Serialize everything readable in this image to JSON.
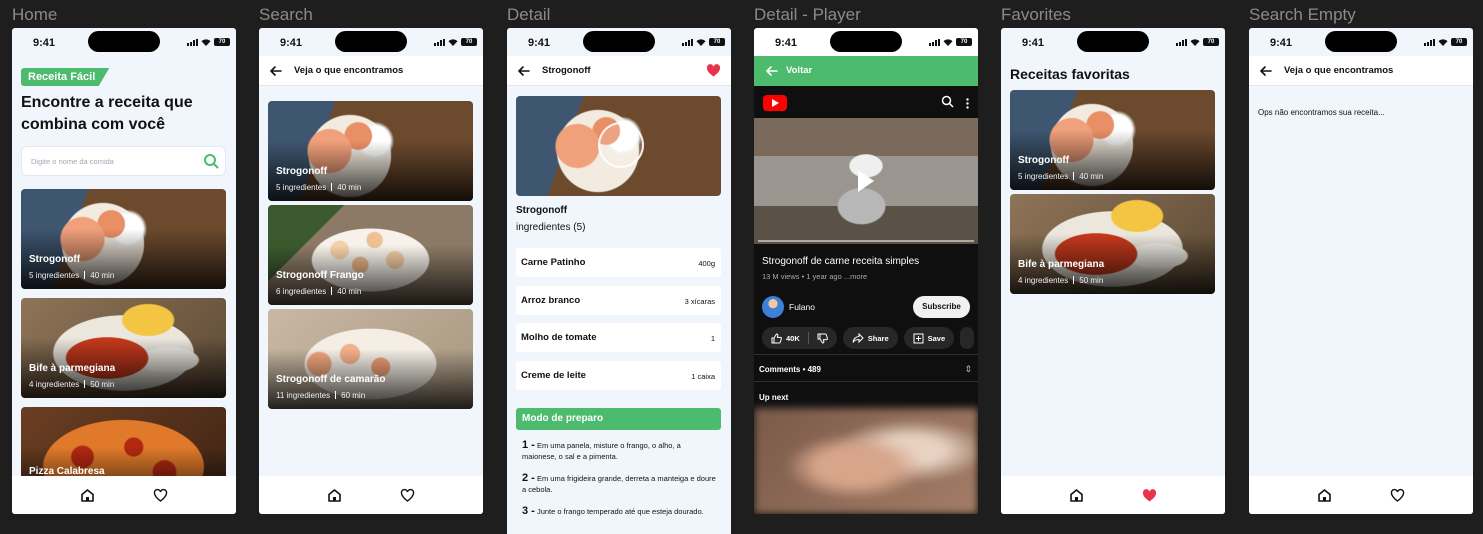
{
  "frames": [
    {
      "label": "Home"
    },
    {
      "label": "Search"
    },
    {
      "label": "Detail"
    },
    {
      "label": "Detail - Player"
    },
    {
      "label": "Favorites"
    },
    {
      "label": "Search Empty"
    }
  ],
  "status": {
    "time": "9:41",
    "battery": "70"
  },
  "home": {
    "brand": "Receita Fácil",
    "headline": "Encontre a receita que combina com você",
    "search_placeholder": "Digite o nome da comida",
    "recipes": [
      {
        "name": "Strogonoff",
        "ingredients": "5 ingredientes",
        "time": "40 min"
      },
      {
        "name": "Bife à parmegiana",
        "ingredients": "4 ingredientes",
        "time": "50 min"
      },
      {
        "name": "Pizza Calabresa"
      }
    ]
  },
  "search": {
    "title": "Veja o que encontramos",
    "results": [
      {
        "name": "Strogonoff",
        "ingredients": "5 ingredientes",
        "time": "40 min"
      },
      {
        "name": "Strogonoff Frango",
        "ingredients": "6 ingredientes",
        "time": "40 min"
      },
      {
        "name": "Strogonoff de camarão",
        "ingredients": "11 ingredientes",
        "time": "60 min"
      }
    ]
  },
  "detail": {
    "title": "Strogonoff",
    "name": "Strogonoff",
    "ingredients_label": "ingredientes (5)",
    "ingredients": [
      {
        "name": "Carne Patinho",
        "qty": "400g"
      },
      {
        "name": "Arroz branco",
        "qty": "3 xícaras"
      },
      {
        "name": "Molho de tomate",
        "qty": "1"
      },
      {
        "name": "Creme de leite",
        "qty": "1 caixa"
      }
    ],
    "prep_title": "Modo de preparo",
    "steps": [
      {
        "num": "1 -",
        "text": "Em uma panela, misture o frango, o alho, a maionese, o sal e a pimenta."
      },
      {
        "num": "2 -",
        "text": "Em uma frigideira grande, derreta a manteiga e doure a cebola."
      },
      {
        "num": "3 -",
        "text": "Junte o frango temperado até que esteja dourado."
      }
    ]
  },
  "player": {
    "back_label": "Voltar",
    "video_title": "Strogonoff de carne receita simples",
    "views": "13 M views • 1 year ago ...more",
    "channel": "Fulano",
    "subscribe": "Subscribe",
    "likes": "40K",
    "share": "Share",
    "save": "Save",
    "comments": "Comments • 489",
    "up_next": "Up next"
  },
  "favorites": {
    "title": "Receitas favoritas",
    "recipes": [
      {
        "name": "Strogonoff",
        "ingredients": "5 ingredientes",
        "time": "40 min"
      },
      {
        "name": "Bife à parmegiana",
        "ingredients": "4 ingredientes",
        "time": "50 min"
      }
    ]
  },
  "search_empty": {
    "title": "Veja o que encontramos",
    "message": "Ops não encontramos sua receita..."
  },
  "colors": {
    "accent": "#4dbb6d",
    "heart": "#e9334b",
    "youtube": "#ff0000"
  }
}
